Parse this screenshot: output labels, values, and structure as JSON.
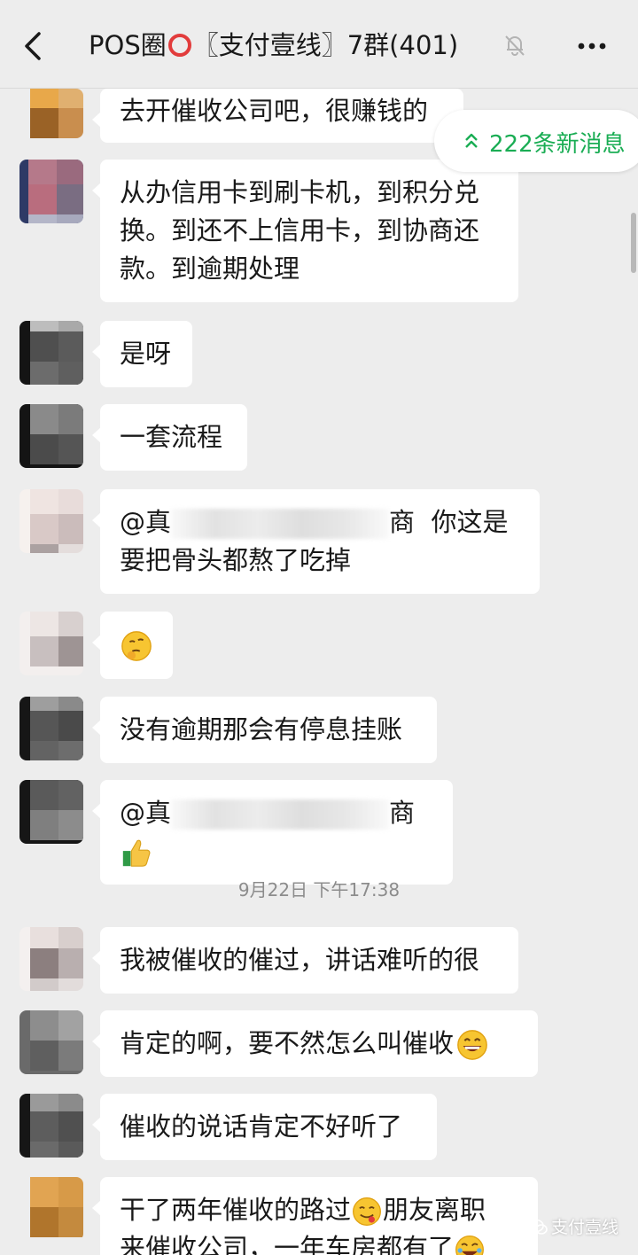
{
  "header": {
    "title_prefix": "POS圈",
    "title_suffix": "〖支付壹线〗7群(401)"
  },
  "new_messages": {
    "label": "222条新消息"
  },
  "messages": {
    "m0": "去开催收公司吧，很赚钱的",
    "m1": "从办信用卡到刷卡机，到积分兑换。到还不上信用卡，到协商还款。到逾期处理",
    "m2": "是呀",
    "m3": "一套流程",
    "m4_at": "@真",
    "m4_end": "商",
    "m4_text": "你这是要把骨头都熬了吃掉",
    "m6": "没有逾期那会有停息挂账",
    "m7_at": "@真",
    "m7_end": "商",
    "m8": "我被催收的催过，讲话难听的很",
    "m9": "肯定的啊，要不然怎么叫催收",
    "m10": "催收的说话肯定不好听了",
    "m11_a": "干了两年催收的路过",
    "m11_b": "朋友离职",
    "m11_c": "来催收公司，一年车房都有了"
  },
  "timestamp": "9月22日 下午17:38",
  "watermark": "支付壹线",
  "colors": {
    "accent": "#1aad54",
    "bubble": "#ffffff",
    "background": "#ededed"
  }
}
